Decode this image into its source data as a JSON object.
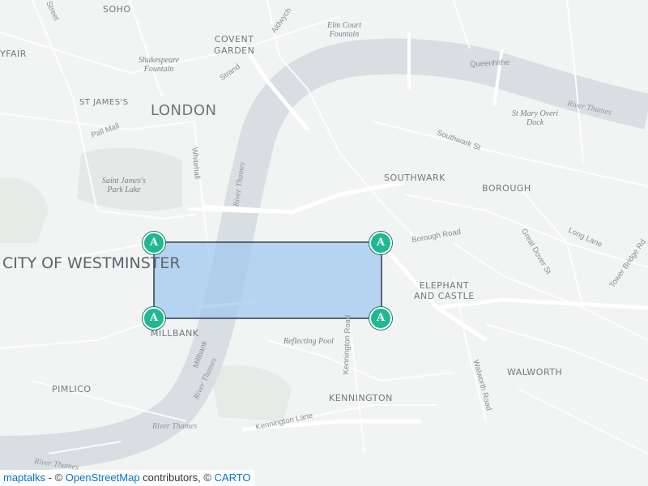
{
  "map": {
    "labels": {
      "soho": "SOHO",
      "mayfair": "YFAIR",
      "covent_garden": "COVENT\nGARDEN",
      "st_james": "ST JAMES'S",
      "london": "LONDON",
      "southwark": "SOUTHWARK",
      "borough": "BOROUGH",
      "elephant_and_castle": "ELEPHANT\nAND CASTLE",
      "westminster": "CITY OF WESTMINSTER",
      "millbank": "MILLBANK",
      "pimlico": "PIMLICO",
      "kennington": "KENNINGTON",
      "walworth": "WALWORTH"
    },
    "poi": {
      "elm_court": "Elm Court\nFountain",
      "shakespeare": "Shakespeare\nFountain",
      "st_marys": "St Mary Overi\nDock",
      "st_james_park": "Saint James's\nPark Lake",
      "reflecting_pool": "Reflecting Pool"
    },
    "streets": {
      "strand": "Strand",
      "aldwych": "Aldwych",
      "pall_mall": "Pall Mall",
      "whitehall": "Whitehall",
      "queenhithe": "Queenhithe",
      "southwark_st": "Southwark St",
      "borough_rd": "Borough Road",
      "great_dover": "Great Dover St",
      "long_lane": "Long Lane",
      "tower_bridge": "Tower Bridge Rd",
      "kennington_rd": "Kennington Road",
      "kennington_ln": "Kennington Lane",
      "walworth_rd": "Walworth Road",
      "millbank_st": "Millbank",
      "cut_label": "Street"
    },
    "water": {
      "thames_ne": "River Thames",
      "thames_v": "River Thames",
      "thames_s1": "River Thames",
      "thames_s2": "River Thames",
      "thames_sw": "River Thames"
    },
    "polygon": {
      "fill": "#9ec8f0",
      "stroke": "#2c3e50",
      "vertex_color": "#1fb893",
      "vertex_label": "A"
    }
  },
  "attribution": {
    "maptalks": "maptalks",
    "sep1": " - © ",
    "osm": "OpenStreetMap",
    "sep2": " contributors, © ",
    "carto": "CARTO"
  }
}
